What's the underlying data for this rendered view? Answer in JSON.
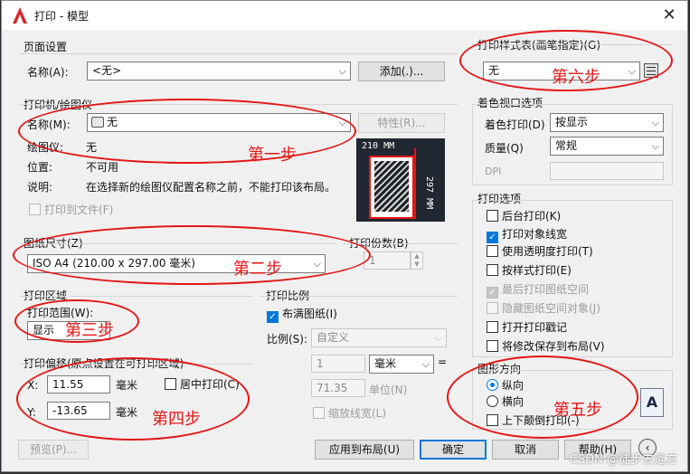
{
  "window": {
    "title": "打印 - 模型",
    "close_glyph": "✕"
  },
  "page_setup": {
    "group": "页面设置",
    "name_label": "名称(A):",
    "name_value": "<无>",
    "add_button": "添加(.)..."
  },
  "plotter": {
    "group": "打印机/绘图仪",
    "name_label": "名称(M):",
    "name_value": "无",
    "properties_button": "特性(R)...",
    "plotter_label": "绘图仪:",
    "plotter_value": "无",
    "location_label": "位置:",
    "location_value": "不可用",
    "desc_label": "说明:",
    "desc_value": "在选择新的绘图仪配置名称之前，不能打印该布局。",
    "print_to_file": "打印到文件(F)",
    "preview_width": "210 MM",
    "preview_height": "297 MM"
  },
  "paper_size": {
    "group": "图纸尺寸(Z)",
    "value": "ISO A4 (210.00 x 297.00 毫米)"
  },
  "copies": {
    "group": "打印份数(B)",
    "value": "1"
  },
  "plot_area": {
    "group": "打印区域",
    "range_label": "打印范围(W):",
    "range_value": "显示"
  },
  "plot_offset": {
    "group": "打印偏移(原点设置在可打印区域)",
    "x_label": "X:",
    "x_value": "11.55",
    "x_unit": "毫米",
    "y_label": "Y:",
    "y_value": "-13.65",
    "y_unit": "毫米",
    "center": "居中打印(C)"
  },
  "plot_scale": {
    "group": "打印比例",
    "fit": "布满图纸(I)",
    "scale_label": "比例(S):",
    "scale_value": "自定义",
    "value1": "1",
    "unit1": "毫米",
    "equals": "=",
    "value2": "71.35",
    "unit2": "单位(N)",
    "lineweights": "缩放线宽(L)"
  },
  "plot_style": {
    "group": "打印样式表(画笔指定)(G)",
    "value": "无"
  },
  "shaded": {
    "group": "着色视口选项",
    "shade_label": "着色打印(D)",
    "shade_value": "按显示",
    "quality_label": "质量(Q)",
    "quality_value": "常规",
    "dpi_label": "DPI"
  },
  "options": {
    "group": "打印选项",
    "items": [
      {
        "label": "后台打印(K)",
        "checked": false,
        "enabled": true
      },
      {
        "label": "打印对象线宽",
        "checked": true,
        "enabled": true
      },
      {
        "label": "使用透明度打印(T)",
        "checked": false,
        "enabled": true
      },
      {
        "label": "按样式打印(E)",
        "checked": false,
        "enabled": true
      },
      {
        "label": "最后打印图纸空间",
        "checked": true,
        "enabled": false
      },
      {
        "label": "隐藏图纸空间对象(J)",
        "checked": false,
        "enabled": false
      },
      {
        "label": "打开打印戳记",
        "checked": false,
        "enabled": true
      },
      {
        "label": "将修改保存到布局(V)",
        "checked": false,
        "enabled": true
      }
    ]
  },
  "orientation": {
    "group": "图形方向",
    "portrait": "纵向",
    "landscape": "横向",
    "upside_down": "上下颠倒打印(-)",
    "icon_letter": "A"
  },
  "footer": {
    "preview": "预览(P)...",
    "apply": "应用到布局(U)",
    "ok": "确定",
    "cancel": "取消",
    "help": "帮助(H)"
  },
  "annotations": {
    "step1": "第一步",
    "step2": "第二步",
    "step3": "第三步",
    "step4": "第四步",
    "step5": "第五步",
    "step6": "第六步"
  },
  "watermark": "CSDN @徒步去远方",
  "icons": [
    "autocad-logo-icon",
    "close-icon",
    "printer-icon",
    "plot-style-edit-icon",
    "portrait-orientation-icon",
    "collapse-arrow-icon"
  ],
  "colors": {
    "accent": "#0078d7",
    "annotation": "#e41515"
  }
}
